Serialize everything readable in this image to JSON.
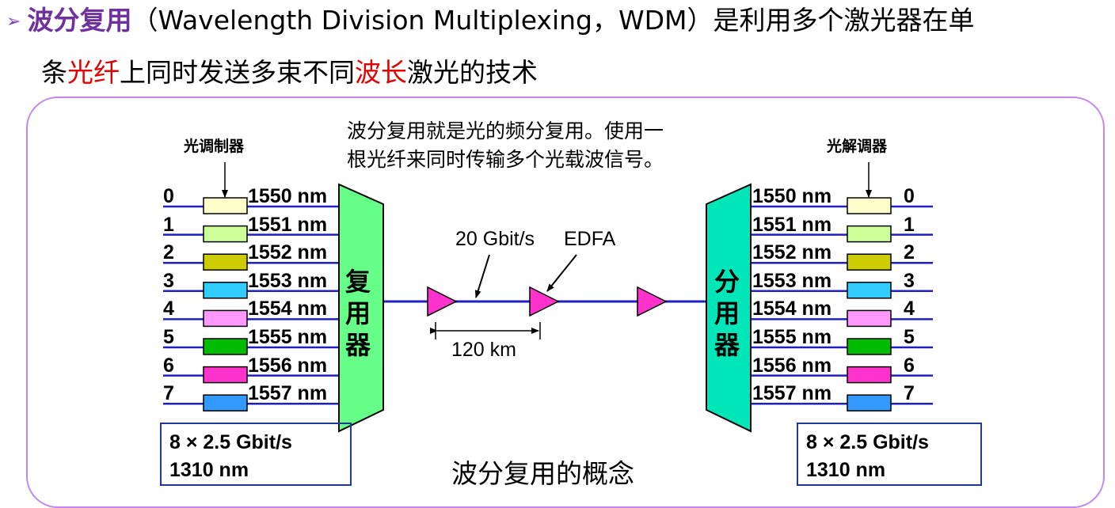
{
  "heading": {
    "bullet_icon": "arrow-right-icon",
    "term": "波分复用",
    "line1_rest": "（Wavelength Division Multiplexing，WDM）是利用多个激光器在单",
    "line2_a": "条",
    "line2_fiber": "光纤",
    "line2_b": "上同时发送多束不同",
    "line2_wave": "波长",
    "line2_c": "激光的技术"
  },
  "diagram": {
    "modulator_label": "光调制器",
    "demodulator_label": "光解调器",
    "description_line1": "波分复用就是光的频分复用。使用一",
    "description_line2": "根光纤来同时传输多个光载波信号。",
    "mux_label": "复用器",
    "demux_label": "分用器",
    "rate_label": "20 Gbit/s",
    "edfa_label": "EDFA",
    "distance_label": "120 km",
    "left_box_line1": "8 × 2.5 Gbit/s",
    "left_box_line2": "1310 nm",
    "right_box_line1": "8 × 2.5 Gbit/s",
    "right_box_line2": "1310 nm",
    "caption": "波分复用的概念",
    "channels": [
      {
        "id": "0",
        "wavelength": "1550 nm",
        "color": "#ffffcc"
      },
      {
        "id": "1",
        "wavelength": "1551 nm",
        "color": "#ccff99"
      },
      {
        "id": "2",
        "wavelength": "1552 nm",
        "color": "#cccc00"
      },
      {
        "id": "3",
        "wavelength": "1553 nm",
        "color": "#33ccff"
      },
      {
        "id": "4",
        "wavelength": "1554 nm",
        "color": "#ff99ff"
      },
      {
        "id": "5",
        "wavelength": "1555 nm",
        "color": "#00bb00"
      },
      {
        "id": "6",
        "wavelength": "1556 nm",
        "color": "#ff33cc"
      },
      {
        "id": "7",
        "wavelength": "1557 nm",
        "color": "#3399ff"
      }
    ],
    "colors": {
      "line": "#2020c0",
      "mux_fill": "#66ff88",
      "demux_fill": "#00e6b8",
      "amplifier_fill": "#ff33cc",
      "frame": "#c586f0",
      "accent": "#7030a0",
      "highlight": "#e00000"
    }
  }
}
